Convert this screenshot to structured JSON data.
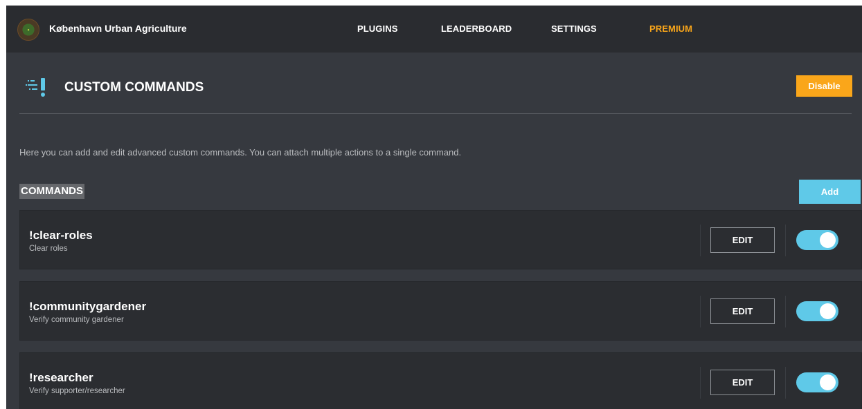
{
  "server": {
    "name": "København Urban Agriculture",
    "avatar_icon": "server-logo-icon"
  },
  "nav": {
    "plugins": "PLUGINS",
    "leaderboard": "LEADERBOARD",
    "settings": "SETTINGS",
    "premium": "PREMIUM"
  },
  "header": {
    "icon": "custom-commands-icon",
    "title": "CUSTOM COMMANDS",
    "disable_label": "Disable"
  },
  "description": "Here you can add and edit advanced custom commands. You can attach multiple actions to a single command.",
  "commands_section": {
    "title": "COMMANDS",
    "add_label": "Add",
    "items": [
      {
        "name": "!clear-roles",
        "description": "Clear roles",
        "edit_label": "EDIT",
        "enabled": true
      },
      {
        "name": "!communitygardener",
        "description": "Verify community gardener",
        "edit_label": "EDIT",
        "enabled": true
      },
      {
        "name": "!researcher",
        "description": "Verify supporter/researcher",
        "edit_label": "EDIT",
        "enabled": true
      }
    ]
  },
  "colors": {
    "background": "#36393f",
    "topbar": "#2a2c30",
    "card": "#2b2d31",
    "premium": "#faa61a",
    "disable_button": "#faa61a",
    "accent": "#5fc9e8"
  }
}
